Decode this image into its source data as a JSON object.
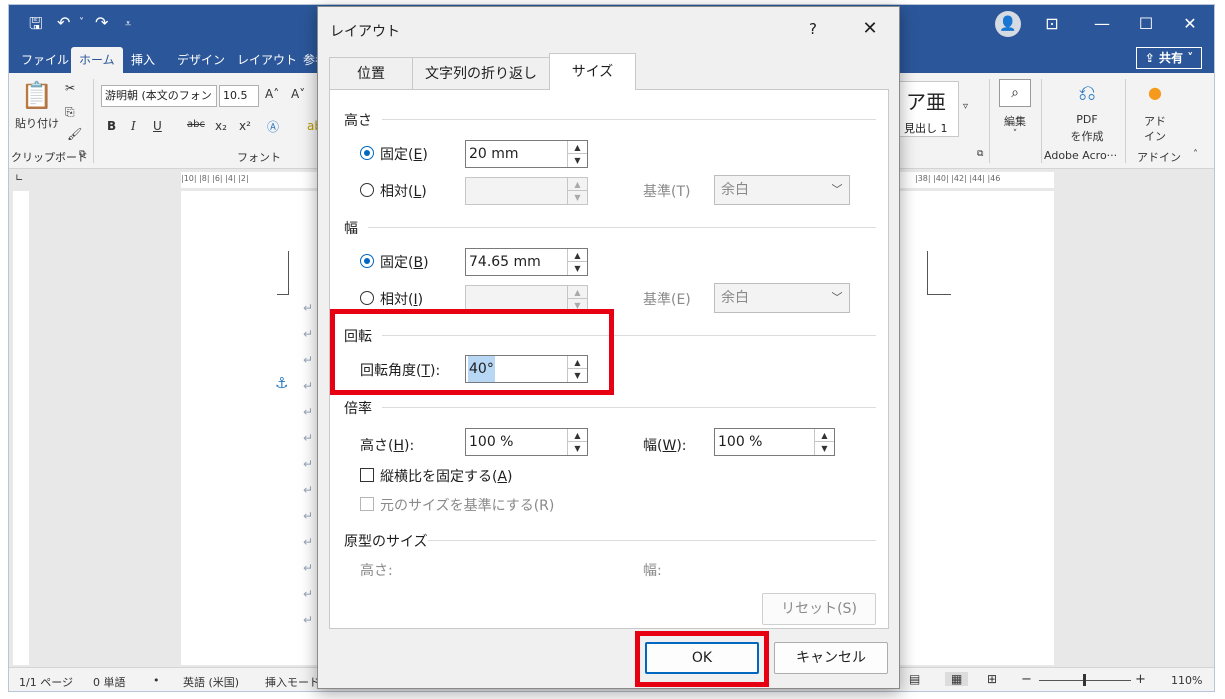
{
  "word": {
    "ribbon_tabs": [
      "ファイル",
      "ホーム",
      "挿入",
      "デザイン",
      "レイアウト",
      "参考"
    ],
    "share_label": "共有",
    "clipboard": {
      "paste_label": "貼り付け",
      "group_label": "クリップボード"
    },
    "font": {
      "font_name": "游明朝 (本文のフォン",
      "font_size": "10.5",
      "group_label": "フォント"
    },
    "styles": {
      "sample": "ア亜",
      "caption": "見出し 1"
    },
    "edit_label": "編集",
    "pdf": {
      "line1": "PDF",
      "line2": "を作成",
      "group_label": "Adobe Acro···"
    },
    "addin": {
      "line1": "アド",
      "line2": "イン",
      "group_label": "アドイン"
    },
    "ruler_left": "|10| |8| |6| |4| |2|",
    "ruler_right": "|38| |40| |42| |44| |46",
    "status": {
      "page": "1/1 ページ",
      "words": "0 単語",
      "language": "英語 (米国)",
      "mode": "挿入モード",
      "zoom": "110%",
      "zoom_minus": "−",
      "zoom_plus": "+"
    }
  },
  "dialog": {
    "title": "レイアウト",
    "help": "?",
    "close": "✕",
    "tabs": [
      "位置",
      "文字列の折り返し",
      "サイズ"
    ],
    "height_section": {
      "title": "高さ",
      "fixed_label": "固定(",
      "fixed_key": "E",
      "fixed_end": ")",
      "fixed_value": "20 mm",
      "relative_label": "相対(",
      "relative_key": "L",
      "relative_end": ")",
      "relative_value": "",
      "base_label": "基準(T)",
      "base_value": "余白"
    },
    "width_section": {
      "title": "幅",
      "fixed_label": "固定(",
      "fixed_key": "B",
      "fixed_end": ")",
      "fixed_value": "74.65 mm",
      "relative_label": "相対(",
      "relative_key": "I",
      "relative_end": ")",
      "relative_value": "",
      "base_label": "基準(E)",
      "base_value": "余白"
    },
    "rotation_section": {
      "title": "回転",
      "angle_label": "回転角度(",
      "angle_key": "T",
      "angle_end": "):",
      "angle_value": "40°"
    },
    "scale_section": {
      "title": "倍率",
      "height_label": "高さ(",
      "height_key": "H",
      "height_end": "):",
      "height_value": "100 %",
      "width_label": "幅(",
      "width_key": "W",
      "width_end": "):",
      "width_value": "100 %",
      "lock_label": "縦横比を固定する(",
      "lock_key": "A",
      "lock_end": ")",
      "relative_label": "元のサイズを基準にする(R)"
    },
    "original_section": {
      "title": "原型のサイズ",
      "height_label": "高さ:",
      "width_label": "幅:",
      "reset_label": "リセット(S)"
    },
    "ok_label": "OK",
    "cancel_label": "キャンセル"
  },
  "highlight_color": "#e60012",
  "accent_color": "#2b579a"
}
